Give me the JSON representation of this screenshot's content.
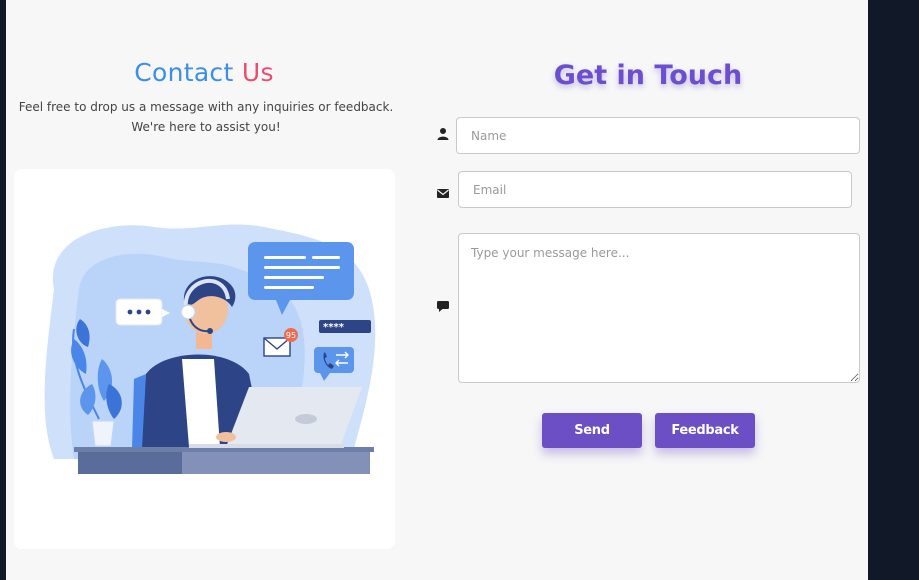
{
  "contact": {
    "title_part1": "Contact",
    "title_part2": "Us",
    "description": "Feel free to drop us a message with any inquiries or feedback. We're here to assist you!"
  },
  "illustration": {
    "badge_count": "95",
    "password_mask": "****"
  },
  "form": {
    "title": "Get in Touch",
    "name_placeholder": "Name",
    "email_placeholder": "Email",
    "message_placeholder": "Type your message here...",
    "send_label": "Send",
    "feedback_label": "Feedback"
  },
  "colors": {
    "accent": "#6c4fc4",
    "title_blue": "#3b8fe8",
    "title_pink": "#ef4a6f",
    "panel_bg": "#f7f7f7",
    "frame_bg": "#111827"
  },
  "icons": {
    "name": "user-icon",
    "email": "envelope-icon",
    "message": "comment-icon"
  }
}
